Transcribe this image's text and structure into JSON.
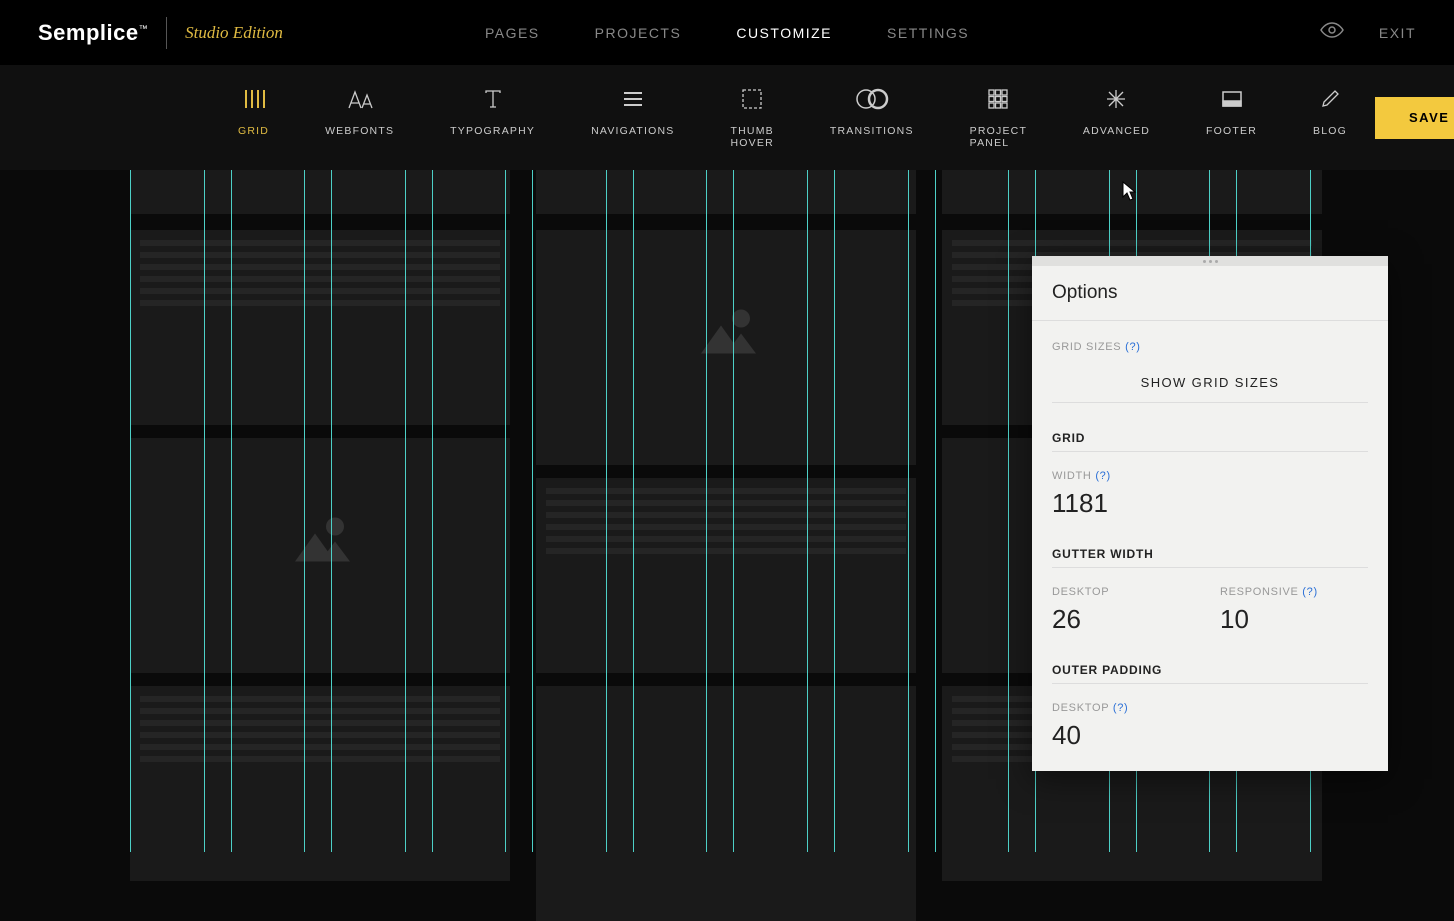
{
  "header": {
    "logo": "Semplice",
    "tm": "™",
    "edition": "Studio Edition",
    "nav": [
      {
        "label": "PAGES",
        "active": false
      },
      {
        "label": "PROJECTS",
        "active": false
      },
      {
        "label": "CUSTOMIZE",
        "active": true
      },
      {
        "label": "SETTINGS",
        "active": false
      }
    ],
    "exit": "EXIT"
  },
  "toolbar": {
    "tools": [
      {
        "label": "GRID",
        "icon": "grid-bars",
        "active": true
      },
      {
        "label": "WEBFONTS",
        "icon": "font",
        "active": false
      },
      {
        "label": "TYPOGRAPHY",
        "icon": "type",
        "active": false
      },
      {
        "label": "NAVIGATIONS",
        "icon": "nav-lines",
        "active": false
      },
      {
        "label": "THUMB HOVER",
        "icon": "marquee",
        "active": false
      },
      {
        "label": "TRANSITIONS",
        "icon": "circles",
        "active": false
      },
      {
        "label": "PROJECT PANEL",
        "icon": "grid9",
        "active": false
      },
      {
        "label": "ADVANCED",
        "icon": "sparkle",
        "active": false
      },
      {
        "label": "FOOTER",
        "icon": "footer",
        "active": false
      },
      {
        "label": "BLOG",
        "icon": "pencil",
        "active": false
      }
    ],
    "save_label": "SAVE"
  },
  "options": {
    "title": "Options",
    "grid_sizes_label": "GRID SIZES",
    "help": "(?)",
    "show_grid_sizes": "SHOW GRID SIZES",
    "grid_hdr": "GRID",
    "width_label": "WIDTH",
    "width_value": "1181",
    "gutter_hdr": "GUTTER WIDTH",
    "desktop_label": "DESKTOP",
    "gutter_desktop": "26",
    "responsive_label": "RESPONSIVE",
    "gutter_responsive": "10",
    "outer_hdr": "OUTER PADDING",
    "outer_desktop": "40"
  }
}
